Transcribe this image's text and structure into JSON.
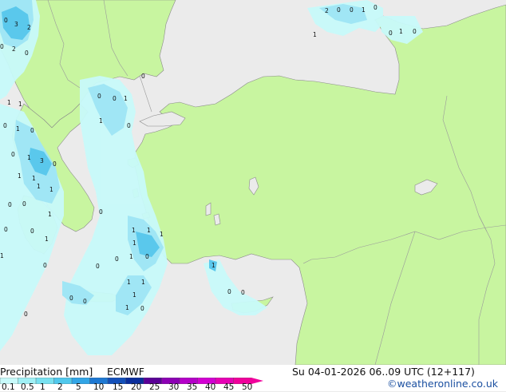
{
  "header": {
    "title": "Precipitation [mm]",
    "model": "ECMWF",
    "valid_time": "Su 04-01-2026 06..09 UTC (12+117)"
  },
  "credit": "©weatheronline.co.uk",
  "legend": {
    "labels": [
      "0.1",
      "0.5",
      "1",
      "2",
      "5",
      "10",
      "15",
      "20",
      "25",
      "30",
      "35",
      "40",
      "45",
      "50"
    ],
    "colors": [
      "#c8fafa",
      "#a0f0f5",
      "#78e1f0",
      "#50c8ec",
      "#32a5e6",
      "#1e78d2",
      "#1450b9",
      "#0a2d9b",
      "#5a0096",
      "#8c00b4",
      "#b400c8",
      "#d200d2",
      "#e600b4",
      "#f0009b"
    ]
  },
  "colors": {
    "land": "#c8f5a0",
    "sea": "#ebebeb",
    "precip_light": "#c8fafa",
    "precip_mid": "#a0e6f5",
    "precip_heavy": "#5ac8ec"
  },
  "map_labels": [
    "2",
    "0",
    "1",
    "0",
    "1",
    "0",
    "0",
    "1",
    "0",
    "0",
    "3",
    "2",
    "0",
    "2",
    "0",
    "1",
    "1",
    "0",
    "0",
    "0",
    "0",
    "1",
    "1",
    "1",
    "0",
    "0",
    "0",
    "1",
    "1",
    "1",
    "0",
    "3",
    "0",
    "0",
    "1",
    "1",
    "1",
    "0",
    "0",
    "1",
    "0",
    "1",
    "1",
    "1",
    "1",
    "1",
    "1",
    "0",
    "1",
    "0",
    "0",
    "0",
    "1",
    "1",
    "1",
    "0",
    "0",
    "0",
    "0",
    "0",
    "1",
    "0"
  ]
}
